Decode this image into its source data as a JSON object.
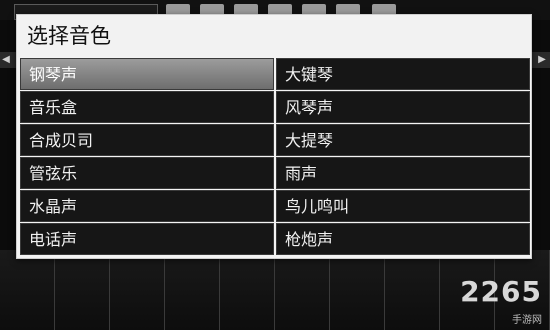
{
  "dialog": {
    "title": "选择音色"
  },
  "options": [
    {
      "label": "钢琴声",
      "selected": true
    },
    {
      "label": "大键琴",
      "selected": false
    },
    {
      "label": "音乐盒",
      "selected": false
    },
    {
      "label": "风琴声",
      "selected": false
    },
    {
      "label": "合成贝司",
      "selected": false
    },
    {
      "label": "大提琴",
      "selected": false
    },
    {
      "label": "管弦乐",
      "selected": false
    },
    {
      "label": "雨声",
      "selected": false
    },
    {
      "label": "水晶声",
      "selected": false
    },
    {
      "label": "鸟儿鸣叫",
      "selected": false
    },
    {
      "label": "电话声",
      "selected": false
    },
    {
      "label": "枪炮声",
      "selected": false
    }
  ],
  "watermark": {
    "main": "2265",
    "sub": "手游网"
  },
  "colors": {
    "selected_bg": "#8a8a8a",
    "cell_bg": "#161616",
    "dialog_bg": "#f4f4f4"
  }
}
